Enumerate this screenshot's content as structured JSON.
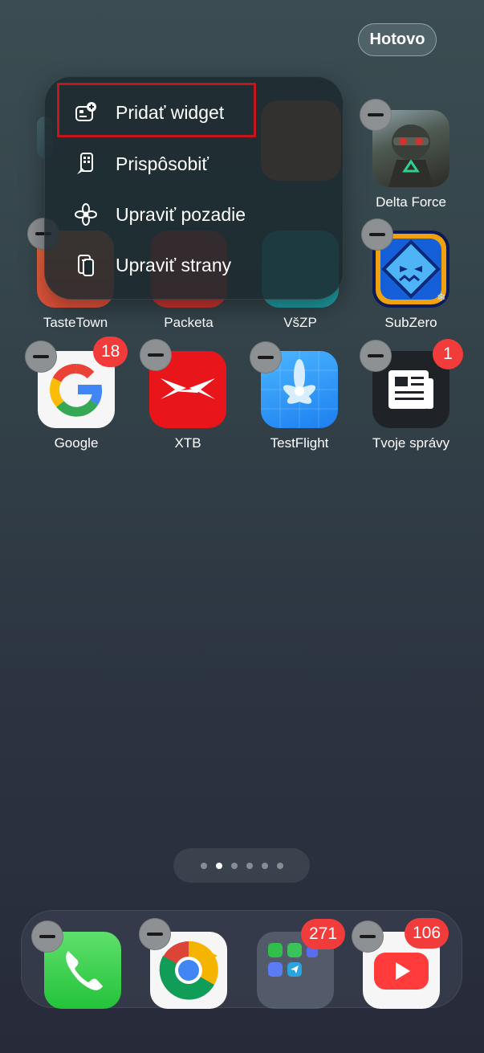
{
  "header": {
    "done_label": "Hotovo"
  },
  "menu": {
    "items": [
      {
        "label": "Pridať widget",
        "icon": "add-widget-icon"
      },
      {
        "label": "Prispôsobiť",
        "icon": "customize-icon"
      },
      {
        "label": "Upraviť pozadie",
        "icon": "wallpaper-icon"
      },
      {
        "label": "Upraviť strany",
        "icon": "edit-pages-icon"
      }
    ]
  },
  "apps": {
    "row1": [
      {
        "label": "Delta Force"
      }
    ],
    "row2": [
      {
        "label": "TasteTown"
      },
      {
        "label": "Packeta"
      },
      {
        "label": "VšZP"
      },
      {
        "label": "SubZero"
      }
    ],
    "row3": [
      {
        "label": "Google",
        "badge": "18"
      },
      {
        "label": "XTB"
      },
      {
        "label": "TestFlight"
      },
      {
        "label": "Tvoje správy",
        "badge": "1"
      }
    ]
  },
  "page_dots": {
    "count": 6,
    "active_index": 1
  },
  "dock": {
    "items": [
      {
        "name": "phone"
      },
      {
        "name": "chrome"
      },
      {
        "name": "folder",
        "badge": "271"
      },
      {
        "name": "youtube",
        "badge": "106"
      }
    ]
  },
  "colors": {
    "badge": "#f23b3b",
    "highlight": "#c4151c",
    "minus": "#8e9193"
  }
}
